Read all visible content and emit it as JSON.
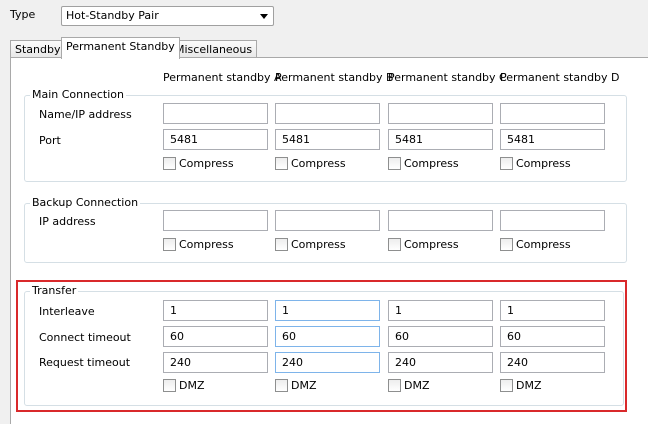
{
  "type_label": "Type",
  "type_select": {
    "value": "Hot-Standby Pair"
  },
  "tabs": [
    {
      "label": "Standby",
      "active": false
    },
    {
      "label": "Permanent Standby",
      "active": true
    },
    {
      "label": "Miscellaneous",
      "active": false
    }
  ],
  "columns": [
    "Permanent standby A",
    "Permanent standby B",
    "Permanent standby C",
    "Permanent standby D"
  ],
  "main_connection": {
    "title": "Main Connection",
    "name_label": "Name/IP address",
    "port_label": "Port",
    "names": [
      "",
      "",
      "",
      ""
    ],
    "ports": [
      "5481",
      "5481",
      "5481",
      "5481"
    ],
    "compress_label": "Compress"
  },
  "backup_connection": {
    "title": "Backup Connection",
    "ip_label": "IP address",
    "ips": [
      "",
      "",
      "",
      ""
    ],
    "compress_label": "Compress"
  },
  "transfer": {
    "title": "Transfer",
    "interleave_label": "Interleave",
    "connect_timeout_label": "Connect timeout",
    "request_timeout_label": "Request timeout",
    "interleave": [
      "1",
      "1",
      "1",
      "1"
    ],
    "connect_timeout": [
      "60",
      "60",
      "60",
      "60"
    ],
    "request_timeout": [
      "240",
      "240",
      "240",
      "240"
    ],
    "dmz_label": "DMZ"
  },
  "colors": {
    "highlight": "#d9292b",
    "focus_border": "#7eb4ea"
  }
}
